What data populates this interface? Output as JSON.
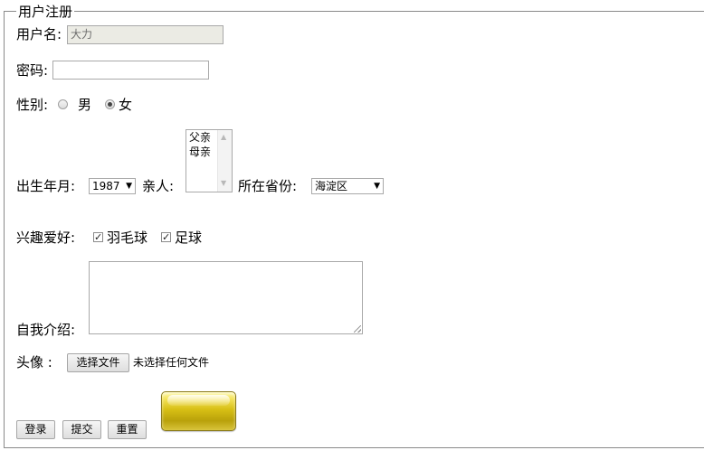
{
  "form": {
    "legend": "用户注册",
    "username": {
      "label": "用户名:",
      "value": "大力"
    },
    "password": {
      "label": "密码:",
      "value": ""
    },
    "gender": {
      "label": "性别:",
      "options": [
        "男",
        "女"
      ],
      "selected": "女"
    },
    "birth": {
      "label": "出生年月:",
      "value": "1987"
    },
    "relatives": {
      "label": "亲人:",
      "options": [
        "父亲",
        "母亲"
      ]
    },
    "province": {
      "label": "所在省份:",
      "value": "海淀区"
    },
    "hobbies": {
      "label": "兴趣爱好:",
      "options": [
        "羽毛球",
        "足球"
      ],
      "checked": [
        "羽毛球",
        "足球"
      ]
    },
    "intro": {
      "label": "自我介绍:",
      "value": ""
    },
    "avatar": {
      "label": "头像 :",
      "button": "选择文件",
      "status": "未选择任何文件"
    },
    "buttons": {
      "login": "登录",
      "submit": "提交",
      "reset": "重置"
    }
  },
  "icons": {
    "dropdown": "▼",
    "check": "✓",
    "scroll_up": "▲",
    "scroll_down": "▼"
  }
}
